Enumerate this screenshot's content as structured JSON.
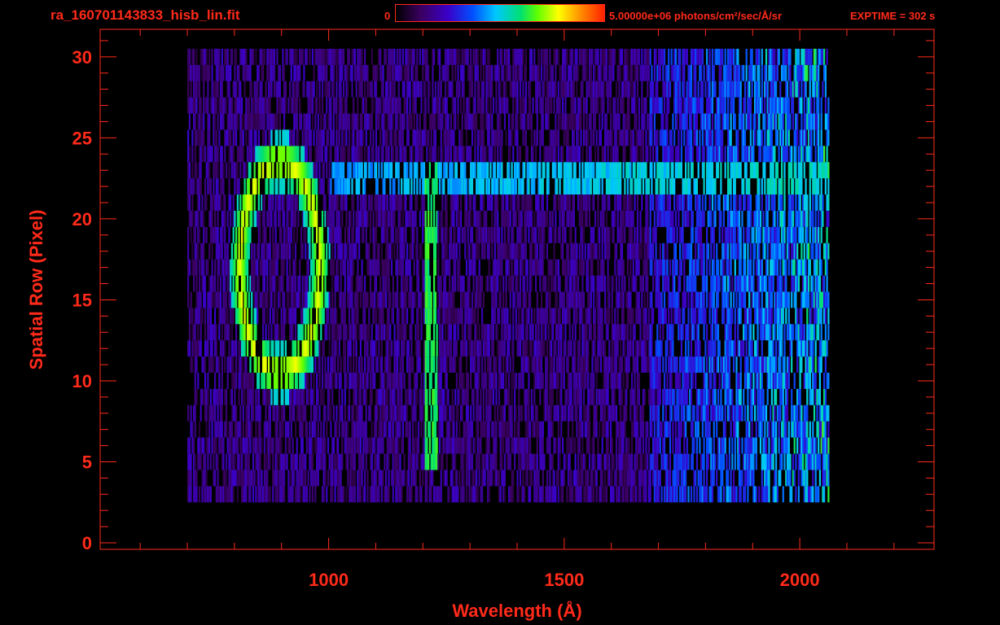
{
  "header": {
    "filename": "ra_160701143833_hisb_lin.fit",
    "colorbar_min": "0",
    "colorbar_max_text": "5.00000e+06 photons/cm²/sec/Å/sr",
    "exptime": "EXPTIME = 302 s"
  },
  "chart_data": {
    "type": "heatmap",
    "title": "",
    "xlabel": "Wavelength (Å)",
    "ylabel": "Spatial Row (Pixel)",
    "xlim": [
      515,
      2285
    ],
    "ylim": [
      -0.4,
      31.7
    ],
    "x_ticks": [
      1000,
      1500,
      2000
    ],
    "y_ticks": [
      0,
      5,
      10,
      15,
      20,
      25,
      30
    ],
    "colorbar": {
      "min": 0,
      "max": 5000000,
      "units": "photons/cm²/sec/Å/sr"
    },
    "features": [
      {
        "name": "O-shaped bright loop",
        "x_range": [
          790,
          1000
        ],
        "y_range": [
          10,
          24
        ]
      },
      {
        "name": "bright vertical line",
        "x": 1216,
        "y_range": [
          5,
          24
        ]
      },
      {
        "name": "horizontal bright band",
        "x_range": [
          1000,
          2060
        ],
        "y_range": [
          22,
          24
        ]
      }
    ],
    "data_extent": {
      "x": [
        700,
        2060
      ],
      "y": [
        3,
        30
      ]
    }
  },
  "colors": {
    "axis": "#ff2a1a",
    "background": "#000000"
  }
}
